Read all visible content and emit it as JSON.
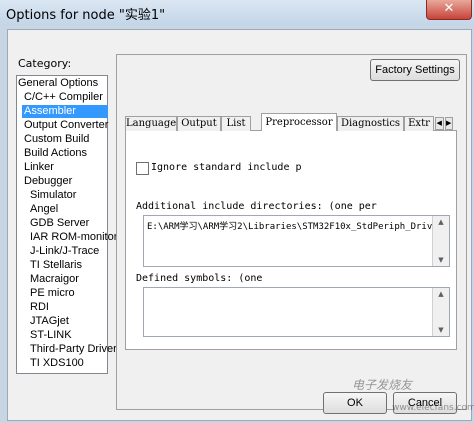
{
  "window": {
    "title": "Options for node \"实验1\"",
    "close_glyph": "✕"
  },
  "category": {
    "label": "Category:",
    "items": [
      {
        "label": "General Options"
      },
      {
        "label": "C/C++ Compiler"
      },
      {
        "label": "Assembler"
      },
      {
        "label": "Output Converter"
      },
      {
        "label": "Custom Build"
      },
      {
        "label": "Build Actions"
      },
      {
        "label": "Linker"
      },
      {
        "label": "Debugger"
      },
      {
        "label": "Simulator"
      },
      {
        "label": "Angel"
      },
      {
        "label": "GDB Server"
      },
      {
        "label": "IAR ROM-monitor"
      },
      {
        "label": "J-Link/J-Trace"
      },
      {
        "label": "TI Stellaris"
      },
      {
        "label": "Macraigor"
      },
      {
        "label": "PE micro"
      },
      {
        "label": "RDI"
      },
      {
        "label": "JTAGjet"
      },
      {
        "label": "ST-LINK"
      },
      {
        "label": "Third-Party Driver"
      },
      {
        "label": "TI XDS100"
      }
    ],
    "selected": "Assembler"
  },
  "factory_settings_label": "Factory Settings",
  "tabs": [
    {
      "label": "Language"
    },
    {
      "label": "Output"
    },
    {
      "label": "List"
    },
    {
      "label": "Preprocessor"
    },
    {
      "label": "Diagnostics"
    },
    {
      "label": "Extr"
    }
  ],
  "active_tab": "Preprocessor",
  "preprocessor": {
    "ignore_std_include_label": "Ignore standard include p",
    "ignore_std_include_checked": false,
    "include_dirs_label": "Additional include directories:  (one per",
    "include_dirs_value": "E:\\ARM学习\\ARM学习2\\Libraries\\STM32F10x_StdPeriph_Driv",
    "defined_symbols_label": "Defined symbols:  (one",
    "defined_symbols_value": ""
  },
  "buttons": {
    "ok_label": "OK",
    "cancel_label": "Cancel"
  },
  "watermark": {
    "text": "电子发烧友",
    "url": "www.elecfans.com"
  },
  "colors": {
    "selection": "#3399ff",
    "client_bg": "#f0f0f0",
    "frame": "#c8d6e4"
  }
}
